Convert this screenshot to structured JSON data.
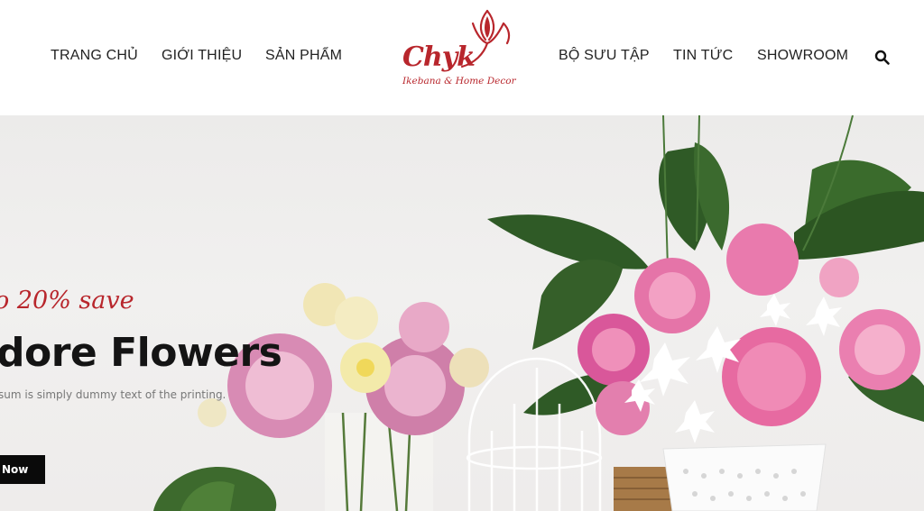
{
  "nav": {
    "left": [
      {
        "label": "TRANG CHỦ"
      },
      {
        "label": "GIỚI THIỆU"
      },
      {
        "label": "SẢN PHẨM"
      }
    ],
    "right": [
      {
        "label": "BỘ SƯU TẬP"
      },
      {
        "label": "TIN TỨC"
      },
      {
        "label": "SHOWROOM"
      }
    ],
    "search_icon": "search-icon"
  },
  "logo": {
    "wordmark": "Chyk",
    "tagline": "Ikebana & Home Decor",
    "brand_color": "#b8262c"
  },
  "hero": {
    "promo": "o 20% save",
    "headline": "dore Flowers",
    "subtext": "sum is simply dummy text of the printing.",
    "cta_label": "Now",
    "cta_color": "#0a0a0a"
  }
}
